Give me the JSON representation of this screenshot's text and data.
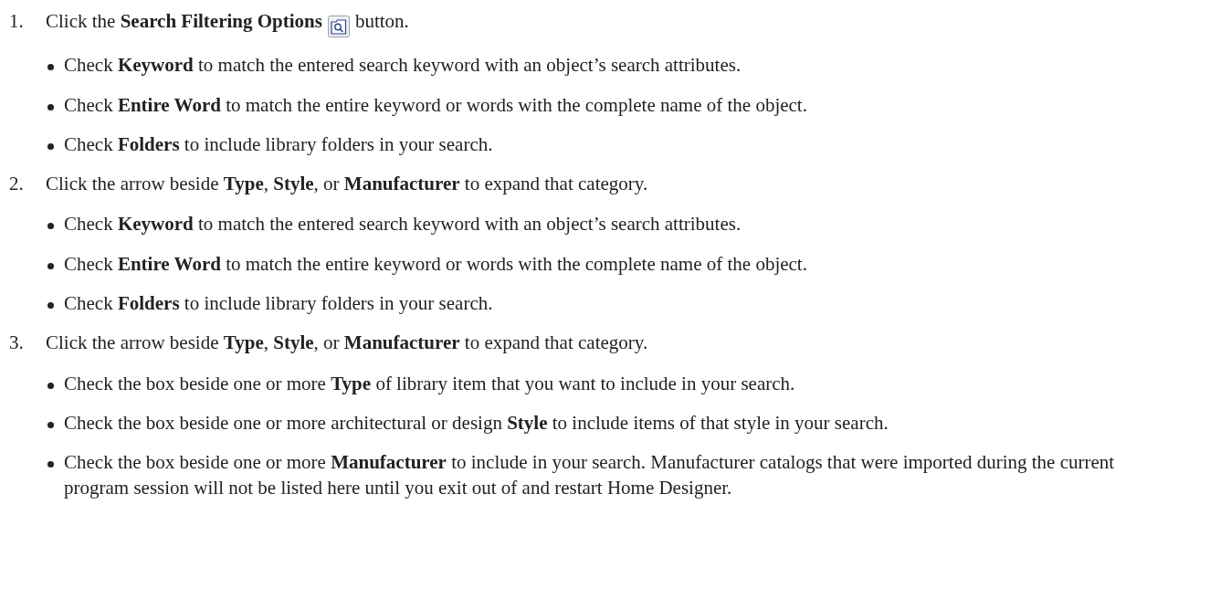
{
  "steps": [
    {
      "number": "1.",
      "parts": [
        {
          "kind": "text",
          "text": "Click the **Search Filtering Options**"
        },
        {
          "kind": "icon"
        },
        {
          "kind": "text",
          "text": "button."
        }
      ],
      "bullets": [
        "Check **Keyword** to match the entered search keyword with an object’s search attributes.",
        "Check **Entire Word** to match the entire keyword or words with the complete name of the object.",
        "Check **Folders** to include library folders in your search."
      ]
    },
    {
      "number": "2.",
      "parts": [
        {
          "kind": "text",
          "text": "Click the arrow beside **Type**, **Style**, or **Manufacturer** to expand that category."
        }
      ],
      "bullets": [
        "Check **Keyword** to match the entered search keyword with an object’s search attributes.",
        "Check **Entire Word** to match the entire keyword or words with the complete name of the object.",
        "Check **Folders** to include library folders in your search."
      ]
    },
    {
      "number": "3.",
      "parts": [
        {
          "kind": "text",
          "text": "Click the arrow beside **Type**, **Style**, or **Manufacturer** to expand that category."
        }
      ],
      "bullets": [
        "Check the box beside one or more **Type** of library item that you want to include in your search.",
        "Check the box beside one or more architectural or design **Style** to include items of that style in your search.",
        "Check the box beside one or more **Manufacturer** to include in your search. Manufacturer catalogs that were imported during the current program session will not be listed here until you exit out of and restart Home Designer."
      ]
    }
  ]
}
